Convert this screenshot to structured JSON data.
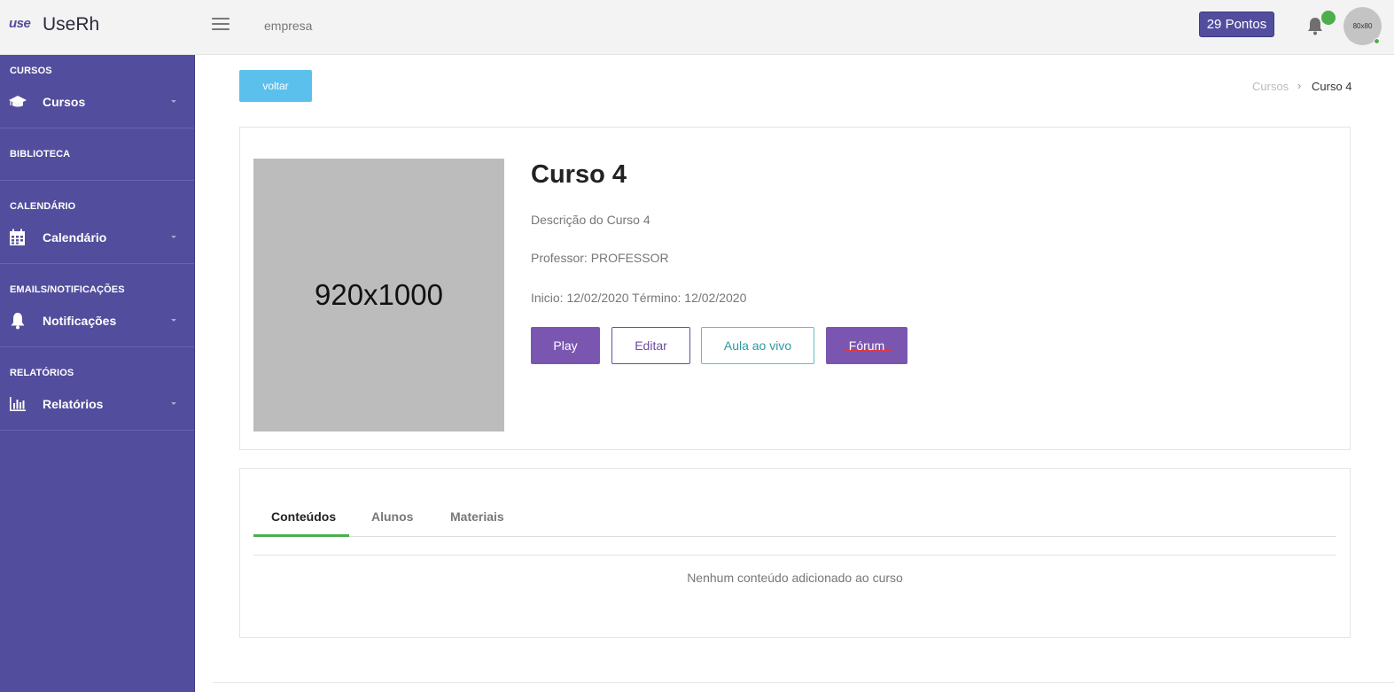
{
  "header": {
    "logo_mark": "use",
    "app_name": "UseRh",
    "company": "empresa",
    "points_label": "29 Pontos",
    "avatar_label": "80x80"
  },
  "sidebar": {
    "sections": [
      {
        "title": "CURSOS",
        "item": "Cursos",
        "icon": "graduation-cap-icon"
      },
      {
        "title": "BIBLIOTECA"
      },
      {
        "title": "CALENDÁRIO",
        "item": "Calendário",
        "icon": "calendar-icon"
      },
      {
        "title": "EMAILS/NOTIFICAÇÕES",
        "item": "Notificações",
        "icon": "bell-icon"
      },
      {
        "title": "RELATÓRIOS",
        "item": "Relatórios",
        "icon": "bar-chart-icon"
      }
    ]
  },
  "page": {
    "back_label": "voltar",
    "breadcrumb": [
      "Cursos",
      "Curso 4"
    ],
    "breadcrumb_separator": "›"
  },
  "course": {
    "image_label": "920x1000",
    "title": "Curso 4",
    "description": "Descrição do Curso 4",
    "professor": "Professor: PROFESSOR",
    "dates": "Inicio: 12/02/2020 Término: 12/02/2020",
    "buttons": {
      "play": "Play",
      "edit": "Editar",
      "live": "Aula ao vivo",
      "forum": "Fórum"
    }
  },
  "tabs": {
    "items": [
      "Conteúdos",
      "Alunos",
      "Materiais"
    ],
    "active": "Conteúdos",
    "empty_message": "Nenhum conteúdo adicionado ao curso"
  },
  "colors": {
    "sidebar": "#524d9c",
    "primary": "#7b56b1",
    "accent_green": "#4cae4c",
    "back_button": "#5bc0eb"
  }
}
